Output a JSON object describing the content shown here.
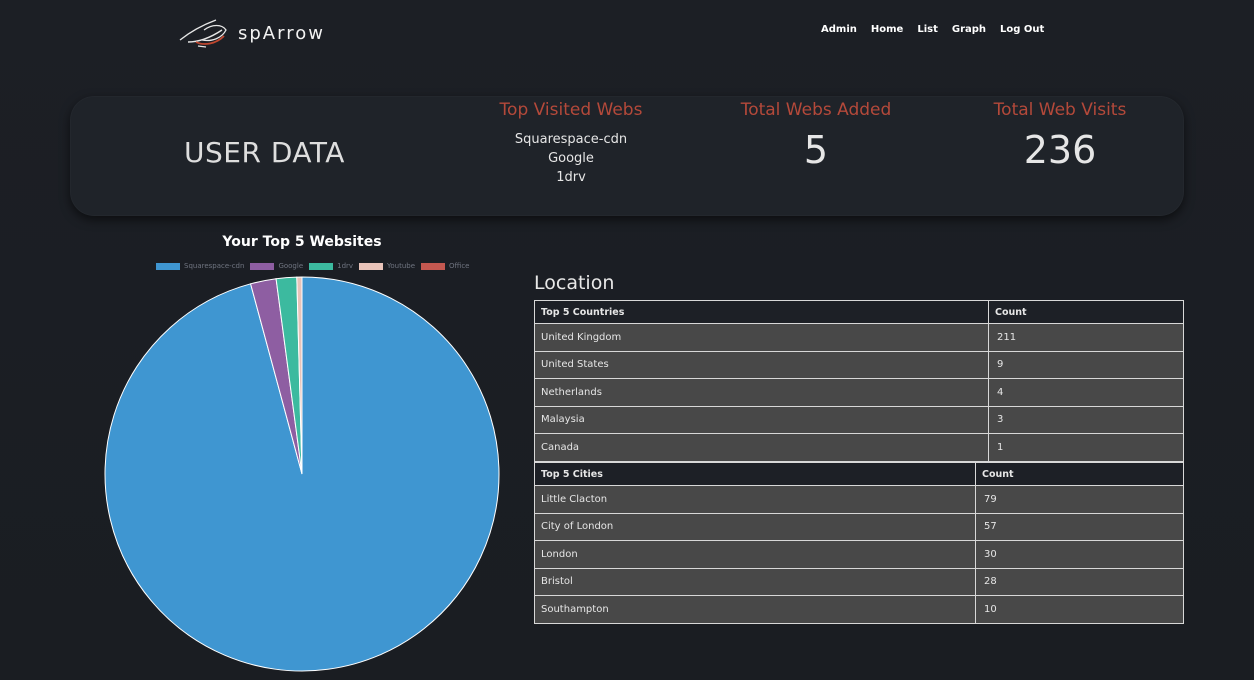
{
  "header": {
    "app_name": "spArrow",
    "nav": [
      "Admin",
      "Home",
      "List",
      "Graph",
      "Log Out"
    ]
  },
  "summary": {
    "title": "USER DATA",
    "top_visited": {
      "title": "Top Visited Webs",
      "items": [
        "Squarespace-cdn",
        "Google",
        "1drv"
      ]
    },
    "total_webs": {
      "title": "Total Webs Added",
      "value": "5"
    },
    "total_visits": {
      "title": "Total Web Visits",
      "value": "236"
    }
  },
  "chart_data": {
    "type": "pie",
    "title": "Your Top 5 Websites",
    "categories": [
      "Squarespace-cdn",
      "Google",
      "1drv",
      "Youtube",
      "Office"
    ],
    "values": [
      228,
      5,
      4,
      1,
      0
    ],
    "colors": [
      "#3f96d1",
      "#8e5ea2",
      "#3cba9f",
      "#e8c3b9",
      "#c45850"
    ],
    "legend": "top"
  },
  "location": {
    "title": "Location",
    "countries": {
      "headers": [
        "Top 5 Countries",
        "Count"
      ],
      "rows": [
        [
          "United Kingdom",
          "211"
        ],
        [
          "United States",
          "9"
        ],
        [
          "Netherlands",
          "4"
        ],
        [
          "Malaysia",
          "3"
        ],
        [
          "Canada",
          "1"
        ]
      ]
    },
    "cities": {
      "headers": [
        "Top 5 Cities",
        "Count"
      ],
      "rows": [
        [
          "Little Clacton",
          "79"
        ],
        [
          "City of London",
          "57"
        ],
        [
          "London",
          "30"
        ],
        [
          "Bristol",
          "28"
        ],
        [
          "Southampton",
          "10"
        ]
      ]
    }
  }
}
